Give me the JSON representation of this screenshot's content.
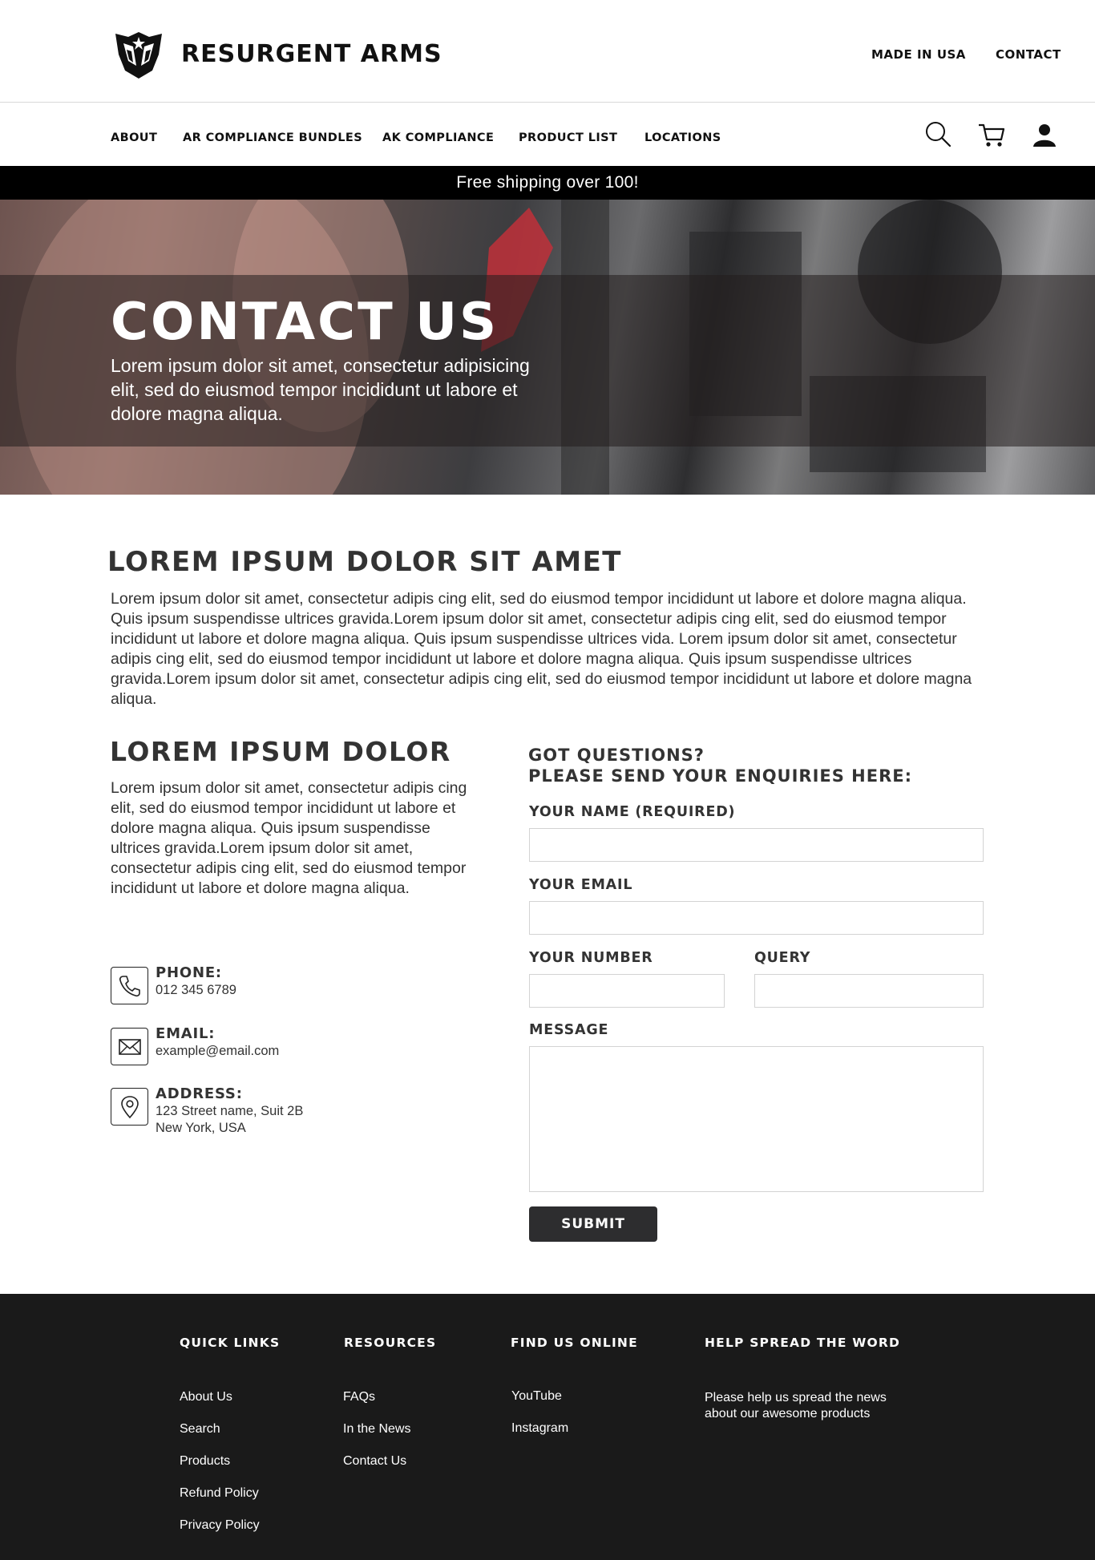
{
  "header": {
    "brand": "RESURGENT ARMS",
    "top_links": [
      "MADE IN USA",
      "CONTACT"
    ]
  },
  "nav": {
    "items": [
      "ABOUT",
      "AR COMPLIANCE BUNDLES",
      "AK COMPLIANCE",
      "PRODUCT LIST",
      "LOCATIONS"
    ],
    "icons": [
      "search-icon",
      "cart-icon",
      "user-icon"
    ]
  },
  "promo": "Free shipping over 100!",
  "hero": {
    "title": "CONTACT US",
    "text": "Lorem ipsum dolor sit amet, consectetur adipisicing elit, sed do eiusmod tempor incididunt ut labore et dolore magna aliqua."
  },
  "intro": {
    "heading": "LOREM IPSUM DOLOR SIT AMET",
    "body": "Lorem ipsum dolor sit amet, consectetur adipis cing elit, sed do eiusmod tempor incididunt ut labore et dolore magna aliqua. Quis ipsum suspendisse ultrices gravida.Lorem ipsum dolor sit amet, consectetur adipis cing elit, sed do eiusmod tempor incididunt ut labore et dolore magna aliqua. Quis ipsum suspendisse ultrices vida. Lorem ipsum dolor sit amet, consectetur adipis cing elit, sed do eiusmod tempor incididunt ut labore et dolore magna aliqua. Quis ipsum suspendisse ultrices gravida.Lorem ipsum dolor sit amet, consectetur adipis cing elit, sed do eiusmod tempor incididunt ut labore et dolore magna aliqua."
  },
  "info": {
    "heading": "LOREM IPSUM DOLOR",
    "body": "Lorem ipsum dolor sit amet, consectetur adipis cing elit, sed do eiusmod tempor incididunt ut labore et dolore magna aliqua. Quis ipsum suspendisse ultrices gravida.Lorem ipsum dolor sit amet, consectetur adipis cing elit, sed do eiusmod tempor incididunt ut labore et dolore magna aliqua.",
    "phone": {
      "label": "PHONE:",
      "value": "012 345 6789",
      "icon": "phone-icon"
    },
    "email": {
      "label": "EMAIL:",
      "value": "example@email.com",
      "icon": "envelope-icon"
    },
    "address": {
      "label": "ADDRESS:",
      "value": "123 Street name, Suit 2B\nNew York, USA",
      "icon": "map-pin-icon"
    }
  },
  "form": {
    "heading_line1": "GOT QUESTIONS?",
    "heading_line2": "PLEASE SEND YOUR ENQUIRIES HERE:",
    "name_label": "YOUR NAME  (REQUIRED)",
    "email_label": "YOUR EMAIL",
    "number_label": "YOUR NUMBER",
    "query_label": "QUERY",
    "message_label": "MESSAGE",
    "name_value": "",
    "email_value": "",
    "number_value": "",
    "query_value": "",
    "message_value": "",
    "submit_label": "SUBMIT"
  },
  "footer": {
    "columns": [
      {
        "heading": "QUICK LINKS",
        "links": [
          "About Us",
          "Search",
          "Products",
          "Refund Policy",
          "Privacy Policy"
        ]
      },
      {
        "heading": "RESOURCES",
        "links": [
          "FAQs",
          "In the News",
          "Contact Us"
        ]
      },
      {
        "heading": "FIND US ONLINE",
        "links": [
          "YouTube",
          "Instagram"
        ]
      },
      {
        "heading": "HELP SPREAD THE WORD",
        "note": "Please help us spread the news about our awesome products"
      }
    ]
  }
}
